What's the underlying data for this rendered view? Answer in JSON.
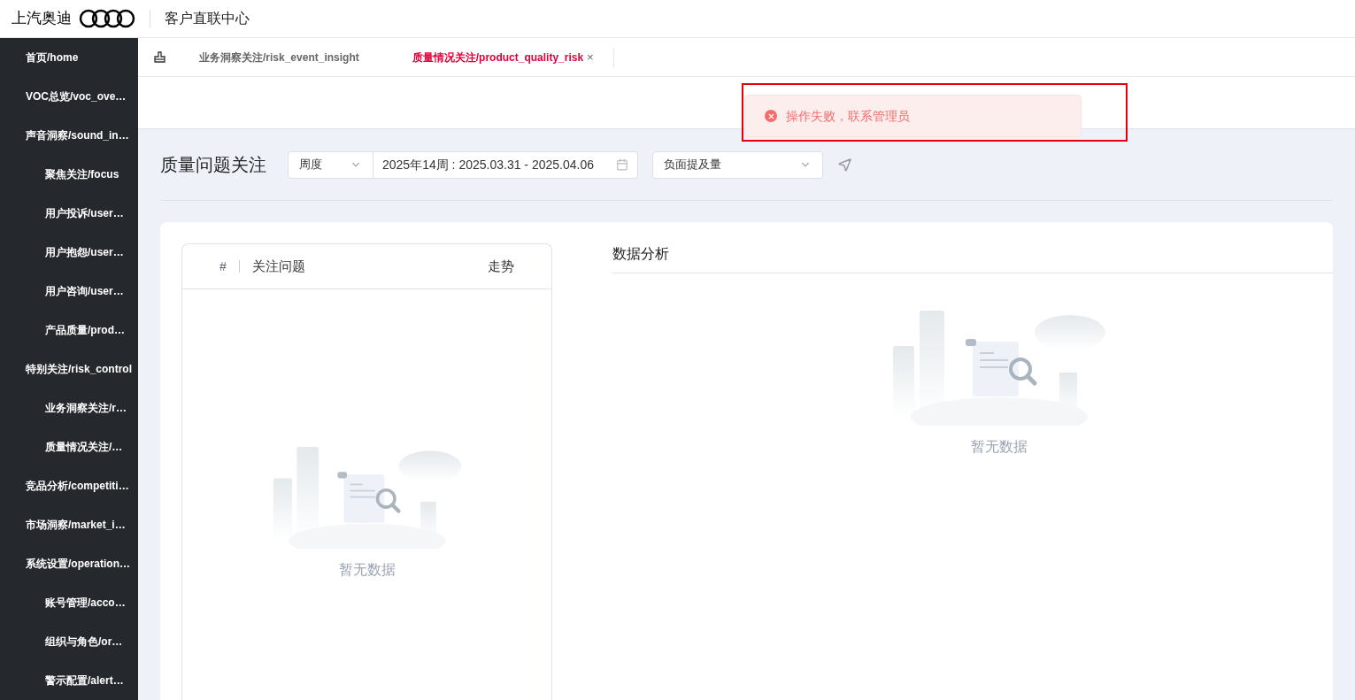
{
  "header": {
    "brand": "上汽奥迪",
    "title": "客户直联中心"
  },
  "sidebar": {
    "items": [
      {
        "label": "首页/home"
      },
      {
        "label": "VOC总览/voc_ove…"
      },
      {
        "label": "声音洞察/sound_in…",
        "children": [
          {
            "label": "聚焦关注/focus"
          },
          {
            "label": "用户投诉/user…"
          },
          {
            "label": "用户抱怨/user…"
          },
          {
            "label": "用户咨询/user…"
          },
          {
            "label": "产品质量/prod…"
          }
        ]
      },
      {
        "label": "特别关注/risk_control",
        "children": [
          {
            "label": "业务洞察关注/r…"
          },
          {
            "label": "质量情况关注/…"
          }
        ]
      },
      {
        "label": "竞品分析/competiti…"
      },
      {
        "label": "市场洞察/market_i…"
      },
      {
        "label": "系统设置/operation…",
        "children": [
          {
            "label": "账号管理/acco…"
          },
          {
            "label": "组织与角色/or…"
          },
          {
            "label": "警示配置/alert…"
          }
        ]
      }
    ]
  },
  "tabs": [
    {
      "label": "业务洞察关注/risk_event_insight",
      "selected": false
    },
    {
      "label": "质量情况关注/product_quality_risk",
      "selected": true,
      "close": "×"
    }
  ],
  "toast": {
    "kind": "error",
    "message": "操作失败，联系管理员"
  },
  "page_title": "质量问题关注",
  "filters": {
    "period": "周度",
    "date_range": "2025年14周 : 2025.03.31 - 2025.04.06",
    "metric": "负面提及量"
  },
  "issue_table": {
    "columns": [
      "#",
      "关注问题",
      "走势"
    ],
    "empty_text": "暂无数据"
  },
  "analysis": {
    "title": "数据分析",
    "empty_text": "暂无数据"
  }
}
